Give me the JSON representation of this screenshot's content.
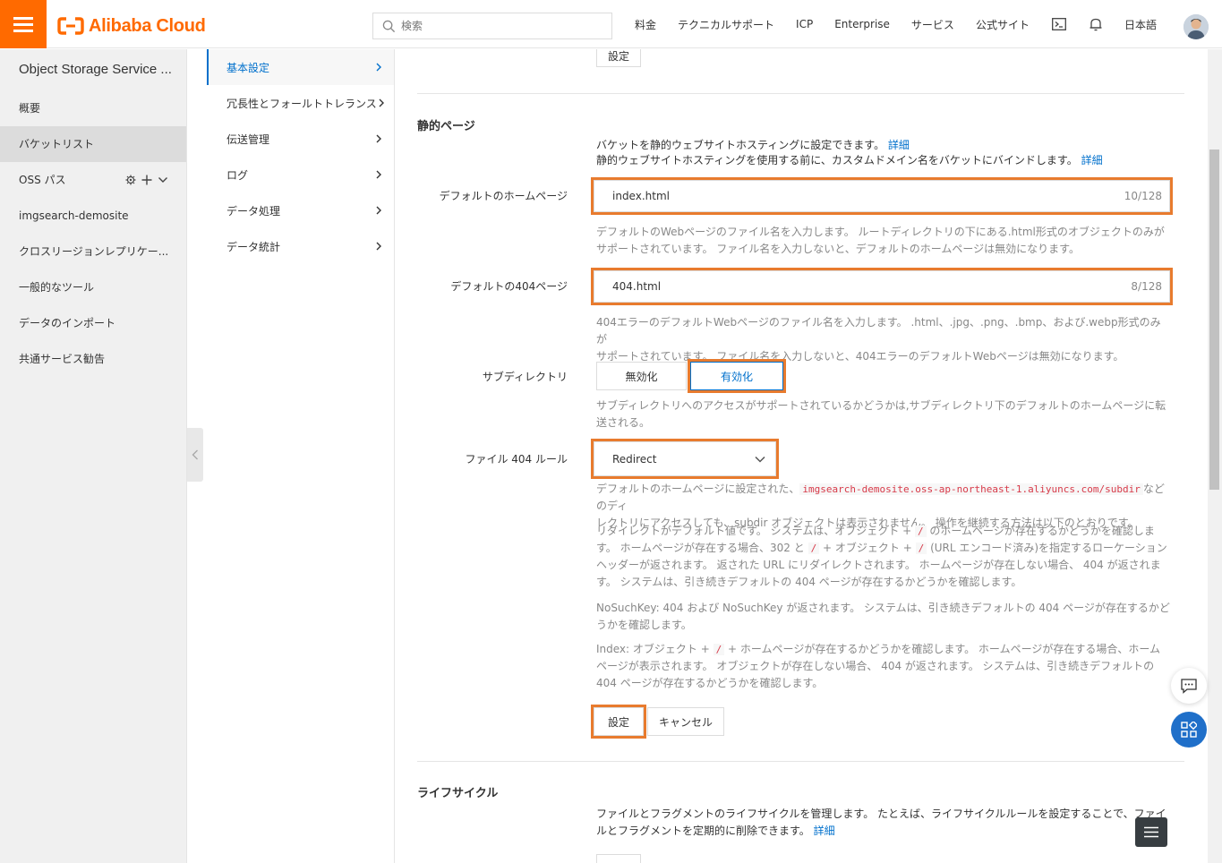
{
  "header": {
    "brand": "Alibaba Cloud",
    "search_placeholder": "検索",
    "nav": [
      "料金",
      "テクニカルサポート",
      "ICP",
      "Enterprise",
      "サービス",
      "公式サイト"
    ],
    "language": "日本語"
  },
  "sidebar": {
    "service_title": "Object Storage Service ...",
    "items": [
      {
        "label": "概要"
      },
      {
        "label": "バケットリスト"
      },
      {
        "label": "OSS パス"
      },
      {
        "label": "imgsearch-demosite"
      },
      {
        "label": "クロスリージョンレプリケー..."
      },
      {
        "label": "一般的なツール"
      },
      {
        "label": "データのインポート"
      },
      {
        "label": "共通サービス勧告"
      }
    ]
  },
  "menu": {
    "items": [
      {
        "label": "基本設定"
      },
      {
        "label": "冗長性とフォールトトレランス"
      },
      {
        "label": "伝送管理"
      },
      {
        "label": "ログ"
      },
      {
        "label": "データ処理"
      },
      {
        "label": "データ統計"
      }
    ]
  },
  "main": {
    "top_settings_button": "設定",
    "static_page": {
      "title": "静的ページ",
      "desc_line1": "バケットを静的ウェブサイトホスティングに設定できます。",
      "desc_line2": "静的ウェブサイトホスティングを使用する前に、カスタムドメイン名をバケットにバインドします。",
      "detail_link": "詳細",
      "homepage_label": "デフォルトのホームページ",
      "homepage_value": "index.html",
      "homepage_count": "10/128",
      "homepage_help1": "デフォルトのWebページのファイル名を入力します。 ルートディレクトリの下にある.html形式のオブジェクトのみが",
      "homepage_help2": "サポートされています。 ファイル名を入力しないと、デフォルトのホームページは無効になります。",
      "page404_label": "デフォルトの404ページ",
      "page404_value": "404.html",
      "page404_count": "8/128",
      "page404_help1": "404エラーのデフォルトWebページのファイル名を入力します。 .html、.jpg、.png、.bmp、および.webp形式のみが",
      "page404_help2": "サポートされています。 ファイル名を入力しないと、404エラーのデフォルトWebページは無効になります。",
      "subdir_label": "サブディレクトリ",
      "subdir_off": "無効化",
      "subdir_on": "有効化",
      "subdir_help1": "サブディレクトリへのアクセスがサポートされているかどうかは,サブディレクトリ下のデフォルトのホームページに転",
      "subdir_help2": "送される。",
      "rule404_label": "ファイル 404 ルール",
      "rule404_value": "Redirect",
      "rule_help_a_pre": "デフォルトのホームページに設定された、",
      "rule_help_a_code": "imgsearch-demosite.oss-ap-northeast-1.aliyuncs.com/subdir",
      "rule_help_a_post": "などのディ",
      "rule_help_a_line2": "レクトリにアクセスしても、subdir オブジェクトは表示されません。 操作を継続する方法は以下のとおりです。",
      "slash": "/",
      "rule_help_b1_pre": "リダイレクトがデフォルト値です。 システムは、オブジェクト +",
      "rule_help_b1_post": "のホームページが存在するかどうかを確認しま",
      "rule_help_b2_pre": "す。 ホームページが存在する場合、302 と",
      "rule_help_b2_mid": "+ オブジェクト +",
      "rule_help_b2_post": "(URL エンコード済み)を指定するローケーション",
      "rule_help_b3": "ヘッダーが返されます。 返された URL にリダイレクトされます。 ホームページが存在しない場合、 404 が返されま",
      "rule_help_b4": "す。 システムは、引き続きデフォルトの 404 ページが存在するかどうかを確認します。",
      "rule_help_c1": "NoSuchKey: 404 および NoSuchKey が返されます。 システムは、引き続きデフォルトの 404 ページが存在するかど",
      "rule_help_c2": "うかを確認します。",
      "rule_help_d1_pre": "Index: オブジェクト +",
      "rule_help_d1_post": "+ ホームページが存在するかどうかを確認します。 ホームページが存在する場合、ホーム",
      "rule_help_d2": "ページが表示されます。 オブジェクトが存在しない場合、 404 が返されます。 システムは、引き続きデフォルトの",
      "rule_help_d3": "404 ページが存在するかどうかを確認します。",
      "save_button": "設定",
      "cancel_button": "キャンセル"
    },
    "lifecycle": {
      "title": "ライフサイクル",
      "desc_line1": "ファイルとフラグメントのライフサイクルを管理します。 たとえば、ライフサイクルルールを設定することで、ファイ",
      "desc_line2": "ルとフラグメントを定期的に削除できます。",
      "detail_link": "詳細"
    }
  },
  "colors": {
    "brand": "#ff6a00",
    "link": "#0070cc",
    "highlight": "#e87b2e",
    "float_button": "#1f6fc9"
  }
}
